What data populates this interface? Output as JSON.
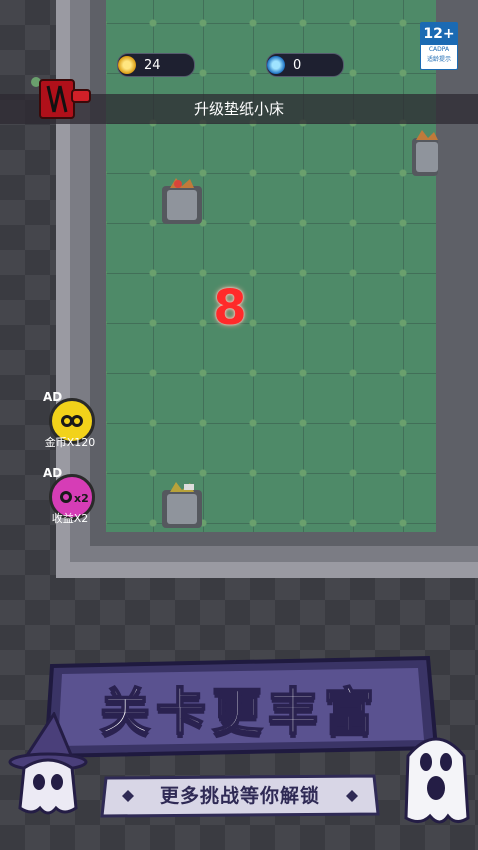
{
  "hud": {
    "gold_count": "24",
    "gem_count": "0",
    "age_rating": "12+",
    "age_org": "CADPA",
    "age_note": "适龄提示"
  },
  "banner": {
    "text": "升级垫纸小床"
  },
  "game": {
    "countdown": "8"
  },
  "side_buttons": [
    {
      "ad": "AD",
      "label": "金币X120",
      "icon": "coin-stack-icon",
      "color": "#f2d21a"
    },
    {
      "ad": "AD",
      "label": "收益X2",
      "icon": "income-double-icon",
      "color": "#d63db6"
    }
  ],
  "promo": {
    "headline": "关卡更丰富",
    "subline": "更多挑战等你解锁"
  },
  "colors": {
    "floor": "#4e8a68",
    "countdown": "#ff2a2a",
    "promo_panel": "#5a5290"
  }
}
